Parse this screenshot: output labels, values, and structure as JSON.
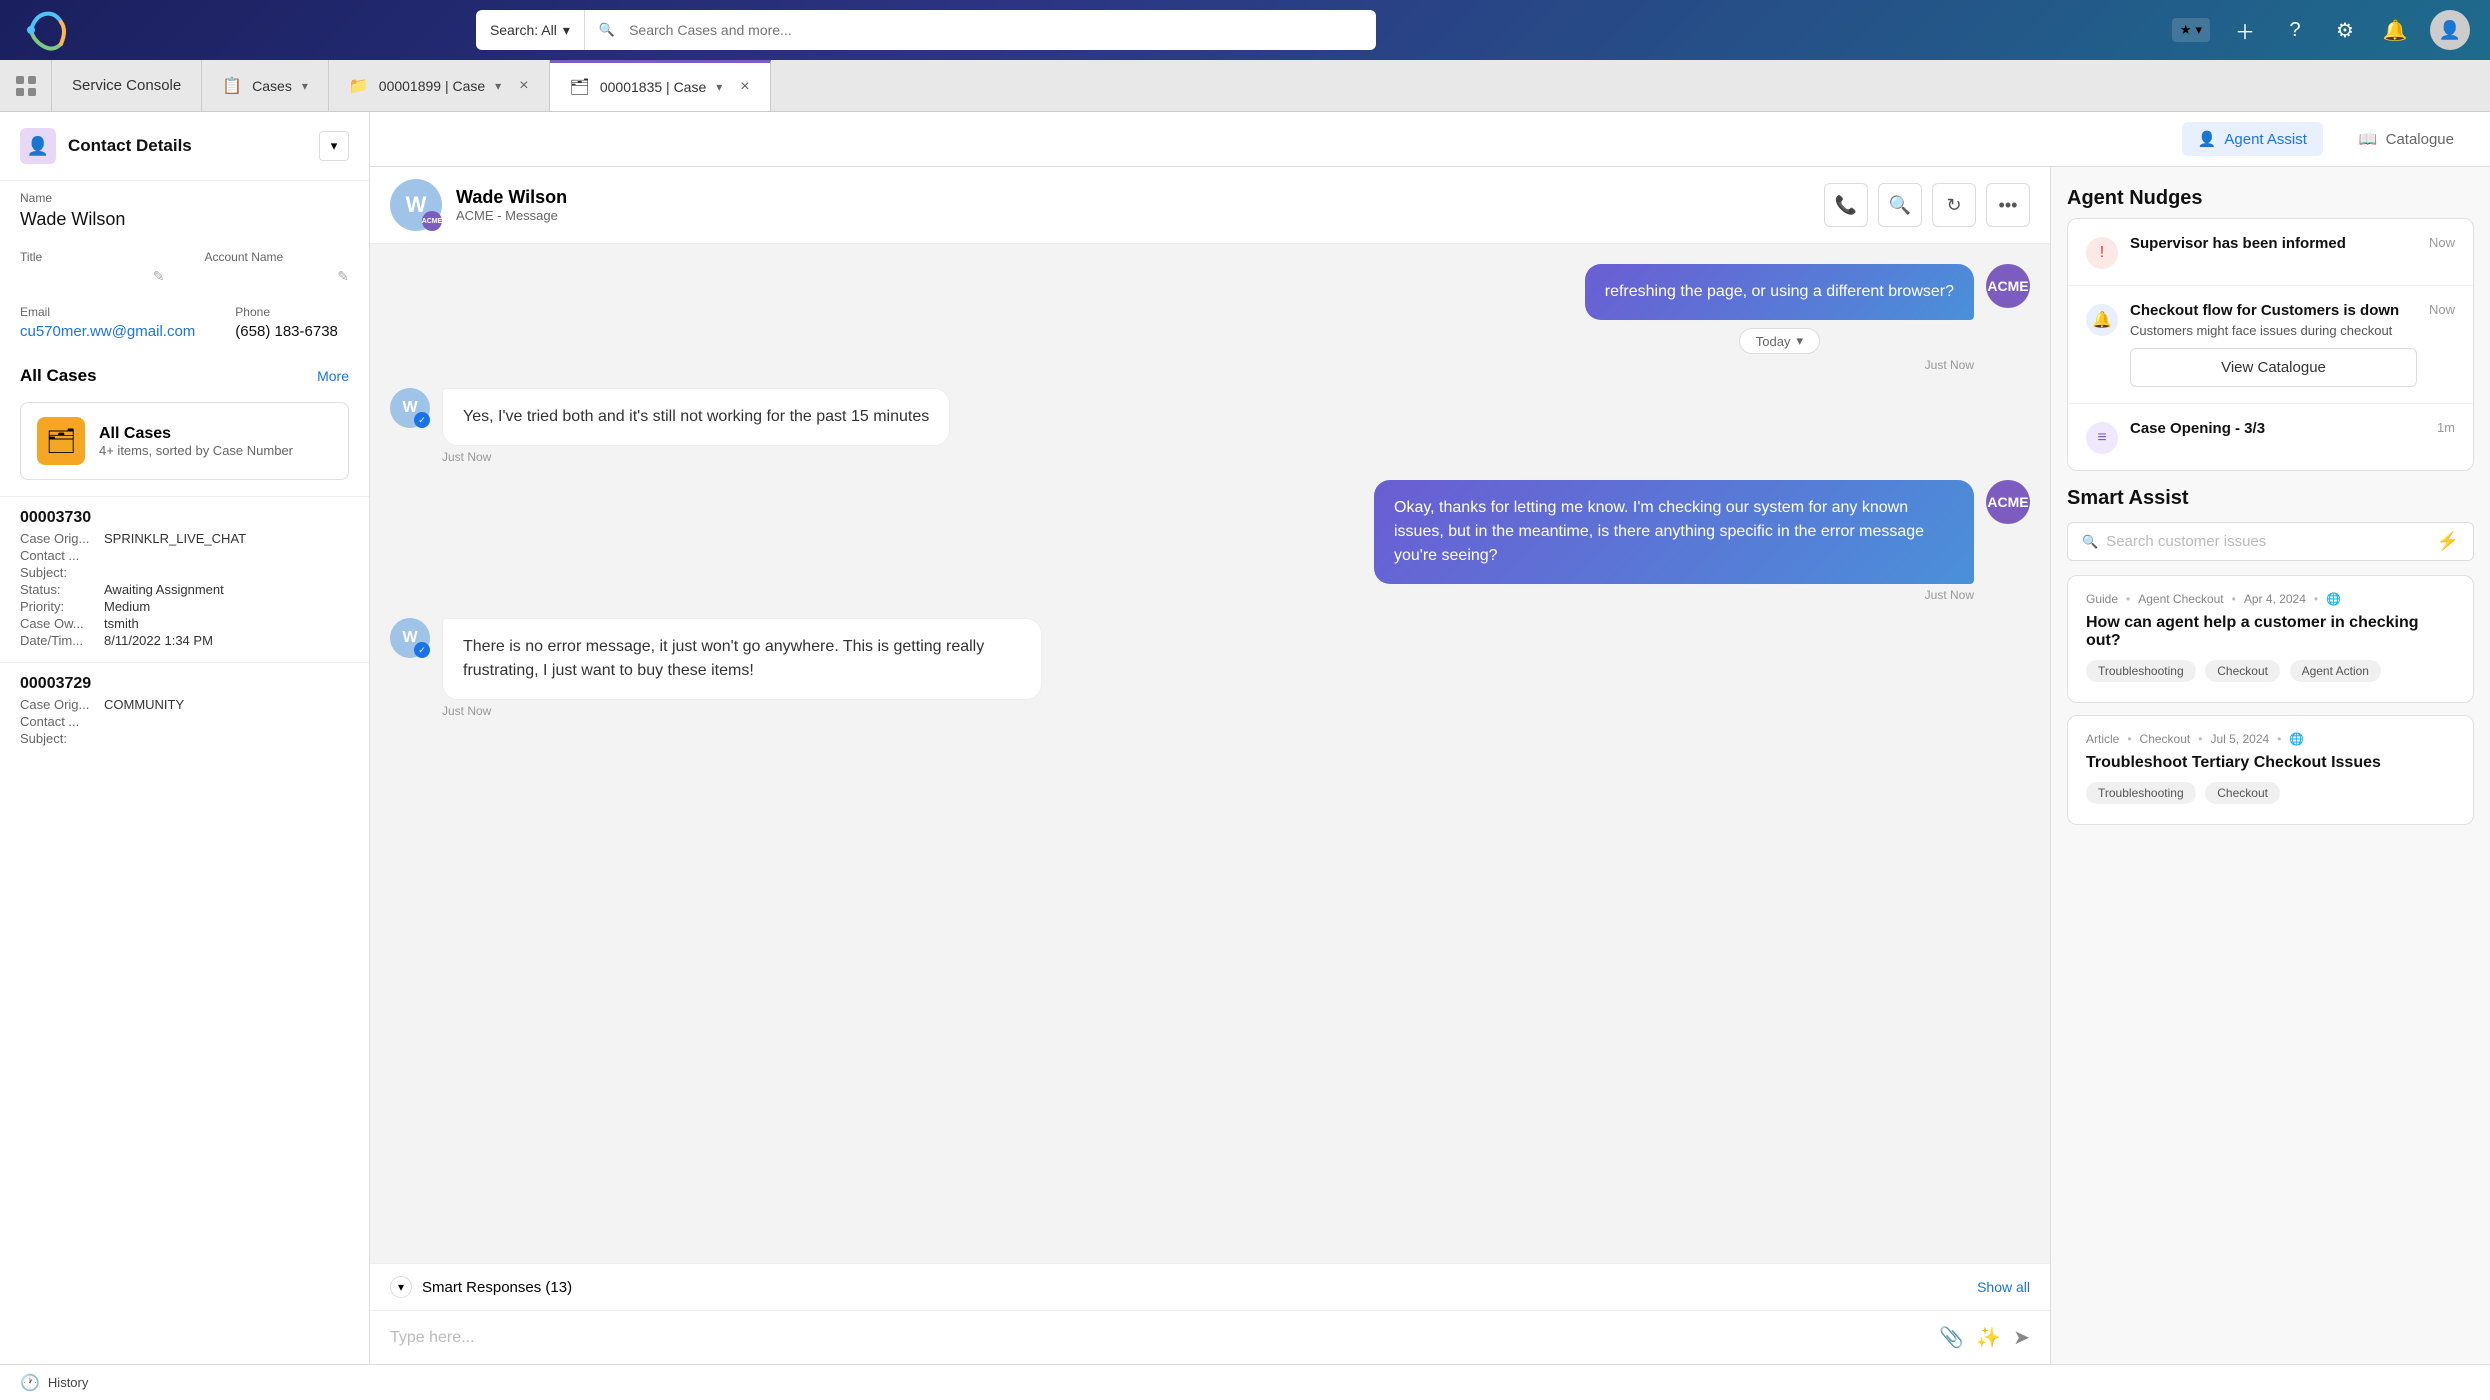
{
  "topNav": {
    "search": {
      "type": "Search: All",
      "placeholder": "Search Cases and more..."
    },
    "icons": [
      "star",
      "plus",
      "help",
      "settings",
      "bell",
      "avatar"
    ]
  },
  "tabs": {
    "appLabel": "Service Console",
    "items": [
      {
        "id": "cases",
        "label": "Cases",
        "icon": "📋",
        "active": false,
        "closeable": false
      },
      {
        "id": "case1899",
        "label": "00001899 | Case",
        "icon": "📁",
        "active": false,
        "closeable": true
      },
      {
        "id": "case1835",
        "label": "00001835 | Case",
        "icon": "🗂",
        "active": true,
        "closeable": true
      }
    ]
  },
  "contactDetails": {
    "title": "Contact Details",
    "fields": {
      "nameLabel": "Name",
      "nameValue": "Wade Wilson",
      "titleLabel": "Title",
      "titleValue": "",
      "accountLabel": "Account Name",
      "accountValue": "",
      "emailLabel": "Email",
      "emailValue": "cu570mer.ww@gmail.com",
      "phoneLabel": "Phone",
      "phoneValue": "(658) 183-6738"
    }
  },
  "allCases": {
    "title": "All Cases",
    "moreLabel": "More",
    "folder": {
      "name": "All Cases",
      "sub": "4+ items, sorted by Case Number"
    },
    "cases": [
      {
        "number": "00003730",
        "origLabel": "Case Orig...",
        "origValue": "SPRINKLR_LIVE_CHAT",
        "contactLabel": "Contact ...",
        "contactValue": "",
        "subjectLabel": "Subject:",
        "subjectValue": "",
        "statusLabel": "Status:",
        "statusValue": "Awaiting Assignment",
        "priorityLabel": "Priority:",
        "priorityValue": "Medium",
        "ownerLabel": "Case Ow...",
        "ownerValue": "tsmith",
        "dateLabel": "Date/Tim...",
        "dateValue": "8/11/2022 1:34 PM"
      },
      {
        "number": "00003729",
        "origLabel": "Case Orig...",
        "origValue": "COMMUNITY",
        "contactLabel": "Contact ...",
        "contactValue": "",
        "subjectLabel": "Subject:",
        "subjectValue": ""
      }
    ]
  },
  "chatHeader": {
    "userName": "Wade Wilson",
    "userSub": "ACME - Message",
    "acmeBadge": "ACME"
  },
  "chatToolbar": {
    "agentAssistLabel": "Agent Assist",
    "catalogueLabel": "Catalogue"
  },
  "messages": [
    {
      "type": "outgoing",
      "text": "refreshing the page, or using a different browser?",
      "time": "Just Now",
      "showDate": true,
      "dateLabel": "Today"
    },
    {
      "type": "incoming",
      "text": "Yes, I've tried both and it's still not working for the past 15 minutes",
      "time": "Just Now"
    },
    {
      "type": "outgoing",
      "text": "Okay, thanks for letting me know. I'm checking our system for any known issues, but in the meantime, is there anything specific in the error message you're seeing?",
      "time": "Just Now"
    },
    {
      "type": "incoming",
      "text": "There is no error message, it just won't go anywhere. This is getting really frustrating, I just want to buy these items!",
      "time": "Just Now"
    }
  ],
  "smartResponses": {
    "label": "Smart Responses (13)",
    "showAllLabel": "Show all"
  },
  "chatInput": {
    "placeholder": "Type here..."
  },
  "agentNudges": {
    "title": "Agent Nudges",
    "nudges": [
      {
        "type": "alert",
        "title": "Supervisor has been informed",
        "time": "Now"
      },
      {
        "type": "bell",
        "title": "Checkout flow for Customers is down",
        "sub": "Customers might face issues during checkout",
        "time": "Now",
        "action": "View Catalogue"
      },
      {
        "type": "list",
        "title": "Case Opening - 3/3",
        "time": "1m"
      }
    ]
  },
  "smartAssist": {
    "title": "Smart Assist",
    "searchPlaceholder": "Search customer issues",
    "cards": [
      {
        "metaType": "Guide",
        "metaCategory": "Agent Checkout",
        "metaDate": "Apr 4, 2024",
        "title": "How can agent help a customer in checking out?",
        "tags": [
          "Troubleshooting",
          "Checkout",
          "Agent Action"
        ]
      },
      {
        "metaType": "Article",
        "metaCategory": "Checkout",
        "metaDate": "Jul 5, 2024",
        "title": "Troubleshoot Tertiary Checkout Issues",
        "tags": [
          "Troubleshooting",
          "Checkout"
        ]
      }
    ]
  },
  "bottomBar": {
    "historyLabel": "History"
  }
}
